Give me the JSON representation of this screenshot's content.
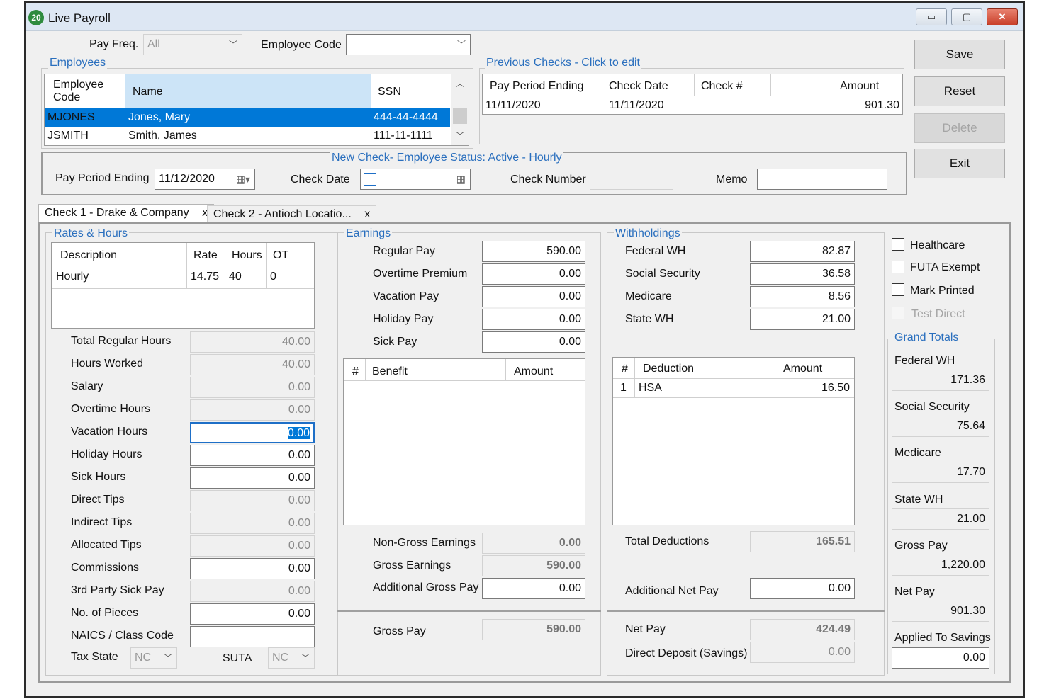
{
  "window": {
    "icon_text": "20",
    "title": "Live Payroll",
    "min_glyph": "▭",
    "max_glyph": "▢",
    "close_glyph": "✕"
  },
  "filters": {
    "pay_freq_label": "Pay Freq.",
    "pay_freq_value": "All",
    "employee_code_label": "Employee Code",
    "employee_code_value": ""
  },
  "employees": {
    "group_title": "Employees",
    "columns": {
      "code": "Employee Code",
      "name": "Name",
      "ssn": "SSN"
    },
    "rows": [
      {
        "code": "MJONES",
        "name": "Jones, Mary",
        "ssn": "444-44-4444"
      },
      {
        "code": "JSMITH",
        "name": "Smith, James",
        "ssn": "111-11-1111"
      }
    ]
  },
  "previous_checks": {
    "group_title": "Previous Checks - Click to edit",
    "columns": {
      "period": "Pay Period Ending",
      "date": "Check Date",
      "number": "Check #",
      "amount": "Amount"
    },
    "rows": [
      {
        "period": "11/11/2020",
        "date": "11/11/2020",
        "number": "",
        "amount": "901.30"
      }
    ]
  },
  "buttons": {
    "save": "Save",
    "reset": "Reset",
    "delete": "Delete",
    "exit": "Exit"
  },
  "new_check": {
    "group_title": "New Check- Employee Status: Active - Hourly",
    "pay_period_label": "Pay Period Ending",
    "pay_period_value": "11/12/2020",
    "check_date_label": "Check Date",
    "check_date_value": "",
    "check_number_label": "Check Number",
    "check_number_value": "",
    "memo_label": "Memo",
    "memo_value": ""
  },
  "tabs": [
    {
      "label": "Check 1 - Drake & Company",
      "close": "x"
    },
    {
      "label": "Check 2 - Antioch Locatio...",
      "close": "x"
    }
  ],
  "rates": {
    "group_title": "Rates & Hours",
    "columns": {
      "desc": "Description",
      "rate": "Rate",
      "hours": "Hours",
      "ot": "OT"
    },
    "rows": [
      {
        "desc": "Hourly",
        "rate": "14.75",
        "hours": "40",
        "ot": "0"
      }
    ],
    "fields": [
      {
        "label": "Total Regular Hours",
        "value": "40.00"
      },
      {
        "label": "Hours Worked",
        "value": "40.00"
      },
      {
        "label": "Salary",
        "value": "0.00"
      },
      {
        "label": "Overtime Hours",
        "value": "0.00"
      },
      {
        "label": "Vacation Hours",
        "value": "0.00"
      },
      {
        "label": "Holiday Hours",
        "value": "0.00"
      },
      {
        "label": "Sick Hours",
        "value": "0.00"
      },
      {
        "label": "Direct Tips",
        "value": "0.00"
      },
      {
        "label": "Indirect Tips",
        "value": "0.00"
      },
      {
        "label": "Allocated Tips",
        "value": "0.00"
      },
      {
        "label": "Commissions",
        "value": "0.00"
      },
      {
        "label": "3rd Party Sick Pay",
        "value": "0.00"
      },
      {
        "label": "No. of Pieces",
        "value": "0.00"
      },
      {
        "label": "NAICS / Class Code",
        "value": ""
      }
    ],
    "tax_state_label": "Tax State",
    "tax_state_value": "NC",
    "suta_label": "SUTA",
    "suta_value": "NC"
  },
  "earnings": {
    "group_title": "Earnings",
    "fields": [
      {
        "label": "Regular Pay",
        "value": "590.00"
      },
      {
        "label": "Overtime Premium",
        "value": "0.00"
      },
      {
        "label": "Vacation Pay",
        "value": "0.00"
      },
      {
        "label": "Holiday Pay",
        "value": "0.00"
      },
      {
        "label": "Sick Pay",
        "value": "0.00"
      }
    ],
    "benefit_columns": {
      "num": "#",
      "benefit": "Benefit",
      "amount": "Amount"
    },
    "non_gross_label": "Non-Gross Earnings",
    "non_gross_value": "0.00",
    "gross_earnings_label": "Gross Earnings",
    "gross_earnings_value": "590.00",
    "additional_gross_label": "Additional Gross Pay",
    "additional_gross_value": "0.00",
    "gross_pay_label": "Gross Pay",
    "gross_pay_value": "590.00"
  },
  "withholdings": {
    "group_title": "Withholdings",
    "fields": [
      {
        "label": "Federal WH",
        "value": "82.87"
      },
      {
        "label": "Social Security",
        "value": "36.58"
      },
      {
        "label": "Medicare",
        "value": "8.56"
      },
      {
        "label": "State WH",
        "value": "21.00"
      }
    ],
    "deduction_columns": {
      "num": "#",
      "deduction": "Deduction",
      "amount": "Amount"
    },
    "deductions": [
      {
        "num": "1",
        "name": "HSA",
        "amount": "16.50"
      }
    ],
    "total_deductions_label": "Total Deductions",
    "total_deductions_value": "165.51",
    "additional_net_label": "Additional Net Pay",
    "additional_net_value": "0.00",
    "net_pay_label": "Net Pay",
    "net_pay_value": "424.49",
    "direct_deposit_label": "Direct Deposit (Savings)",
    "direct_deposit_value": "0.00"
  },
  "options": {
    "healthcare": "Healthcare",
    "futa_exempt": "FUTA Exempt",
    "mark_printed": "Mark Printed",
    "test_direct": "Test Direct"
  },
  "grand_totals": {
    "group_title": "Grand Totals",
    "items": [
      {
        "label": "Federal WH",
        "value": "171.36"
      },
      {
        "label": "Social Security",
        "value": "75.64"
      },
      {
        "label": "Medicare",
        "value": "17.70"
      },
      {
        "label": "State WH",
        "value": "21.00"
      },
      {
        "label": "Gross Pay",
        "value": "1,220.00"
      },
      {
        "label": "Net Pay",
        "value": "901.30"
      },
      {
        "label": "Applied To Savings",
        "value": "0.00"
      }
    ]
  },
  "colors": {
    "accent": "#2a6fbe",
    "selection": "#0078d7"
  }
}
